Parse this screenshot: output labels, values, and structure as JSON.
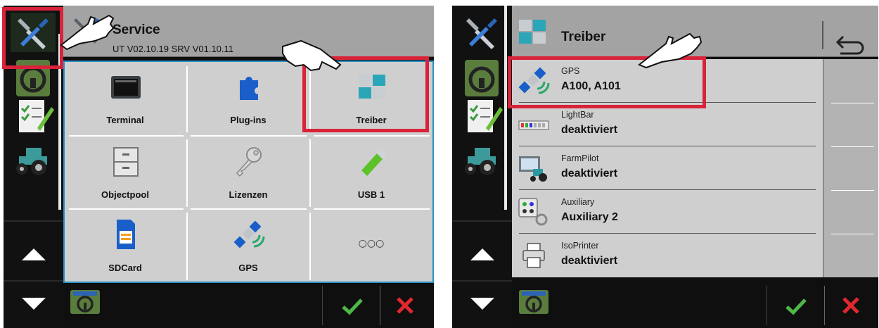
{
  "left": {
    "header": {
      "title": "Service",
      "subtitle": "UT V02.10.19  SRV V01.10.11"
    },
    "tiles": [
      {
        "label": "Terminal",
        "icon": "terminal-icon"
      },
      {
        "label": "Plug-ins",
        "icon": "puzzle-icon"
      },
      {
        "label": "Treiber",
        "icon": "puzzle-blue-icon"
      },
      {
        "label": "Objectpool",
        "icon": "cabinet-icon"
      },
      {
        "label": "Lizenzen",
        "icon": "key-icon"
      },
      {
        "label": "USB 1",
        "icon": "usb-icon"
      },
      {
        "label": "SDCard",
        "icon": "sdcard-icon"
      },
      {
        "label": "GPS",
        "icon": "satellite-icon"
      },
      {
        "label": "○○○",
        "icon": "more-icon"
      }
    ]
  },
  "right": {
    "header": {
      "title": "Treiber"
    },
    "items": [
      {
        "label": "GPS",
        "value": "A100, A101",
        "icon": "satellite-icon"
      },
      {
        "label": "LightBar",
        "value": "deaktiviert",
        "icon": "lightbar-icon"
      },
      {
        "label": "FarmPilot",
        "value": "deaktiviert",
        "icon": "farmpilot-icon"
      },
      {
        "label": "Auxiliary",
        "value": "Auxiliary 2",
        "icon": "auxiliary-icon"
      },
      {
        "label": "IsoPrinter",
        "value": "deaktiviert",
        "icon": "printer-icon"
      }
    ]
  },
  "colors": {
    "highlight": "#d9233a",
    "accept": "#4db848",
    "cancel": "#e2282f",
    "grid_border": "#2b8fc2",
    "tile_bg": "#cfcfcf"
  }
}
